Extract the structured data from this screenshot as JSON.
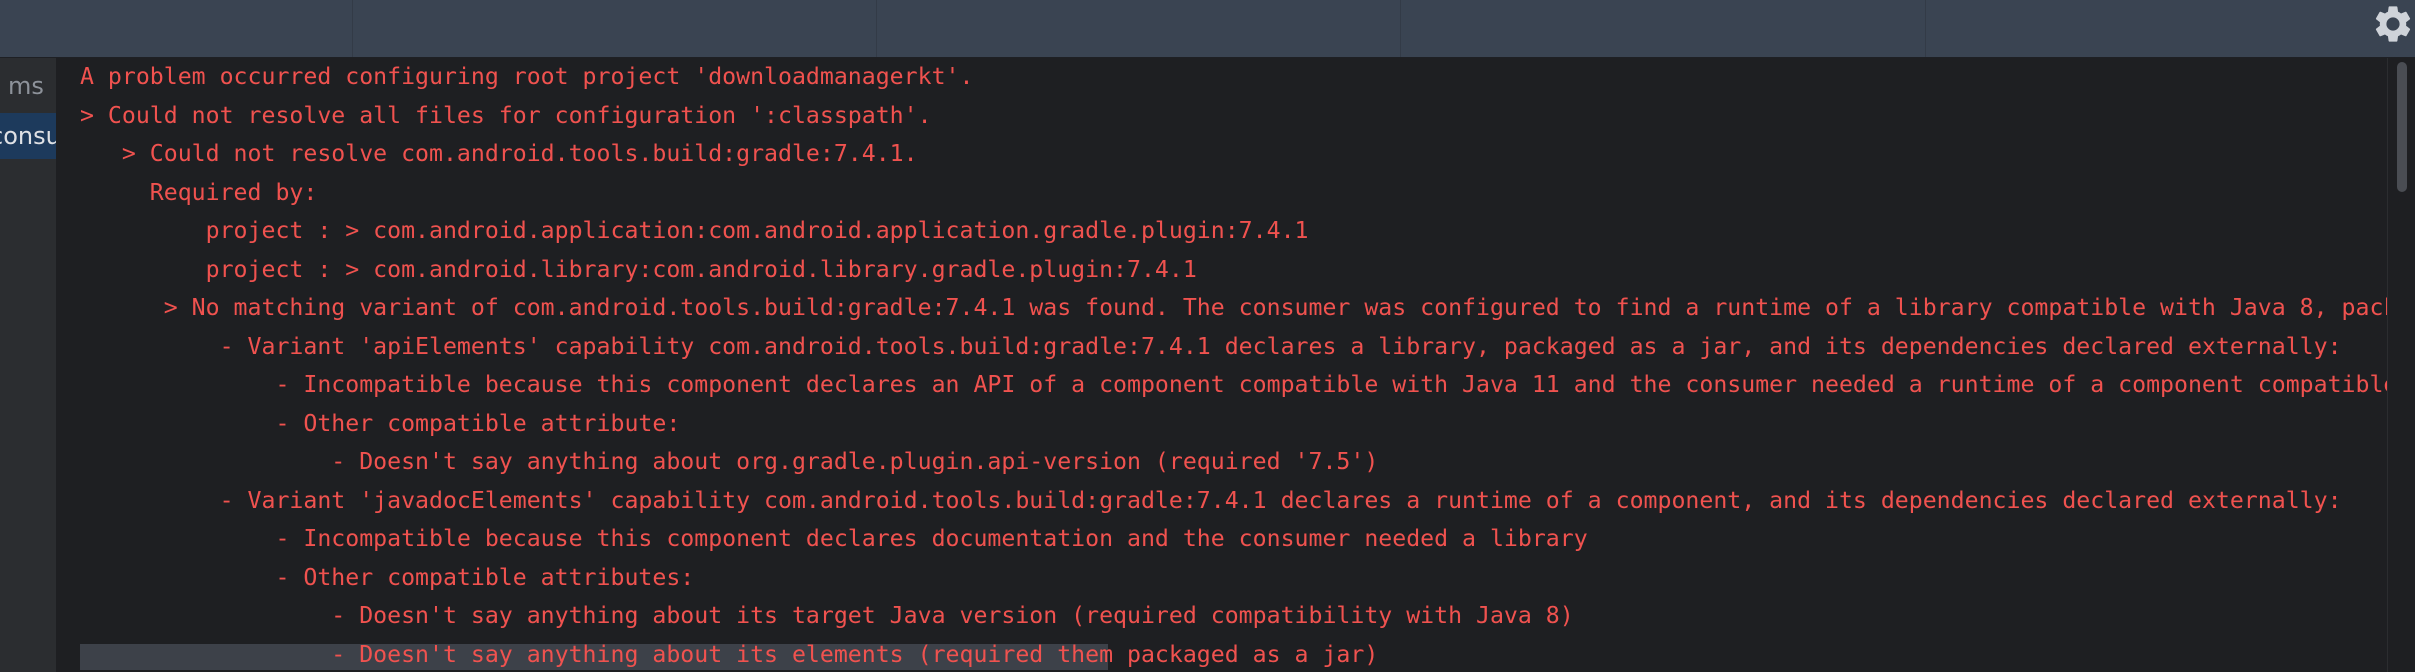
{
  "left_panel": {
    "items": [
      {
        "label": "ms"
      },
      {
        "label": "consu"
      }
    ]
  },
  "console": {
    "lines": [
      "A problem occurred configuring root project 'downloadmanagerkt'.",
      "> Could not resolve all files for configuration ':classpath'.",
      "   > Could not resolve com.android.tools.build:gradle:7.4.1.",
      "     Required by:",
      "         project : > com.android.application:com.android.application.gradle.plugin:7.4.1",
      "         project : > com.android.library:com.android.library.gradle.plugin:7.4.1",
      "      > No matching variant of com.android.tools.build:gradle:7.4.1 was found. The consumer was configured to find a runtime of a library compatible with Java 8, packa",
      "          - Variant 'apiElements' capability com.android.tools.build:gradle:7.4.1 declares a library, packaged as a jar, and its dependencies declared externally:",
      "              - Incompatible because this component declares an API of a component compatible with Java 11 and the consumer needed a runtime of a component compatible",
      "              - Other compatible attribute:",
      "                  - Doesn't say anything about org.gradle.plugin.api-version (required '7.5')",
      "          - Variant 'javadocElements' capability com.android.tools.build:gradle:7.4.1 declares a runtime of a component, and its dependencies declared externally:",
      "              - Incompatible because this component declares documentation and the consumer needed a library",
      "              - Other compatible attributes:",
      "                  - Doesn't say anything about its target Java version (required compatibility with Java 8)",
      "                  - Doesn't say anything about its elements (required them packaged as a jar)"
    ]
  },
  "icons": {
    "settings": "gear-icon"
  },
  "colors": {
    "error_text": "#f0524f",
    "console_bg": "#1e1f22",
    "toolbar_bg": "#3a4452",
    "selected_item_bg": "#1d3a5c"
  }
}
